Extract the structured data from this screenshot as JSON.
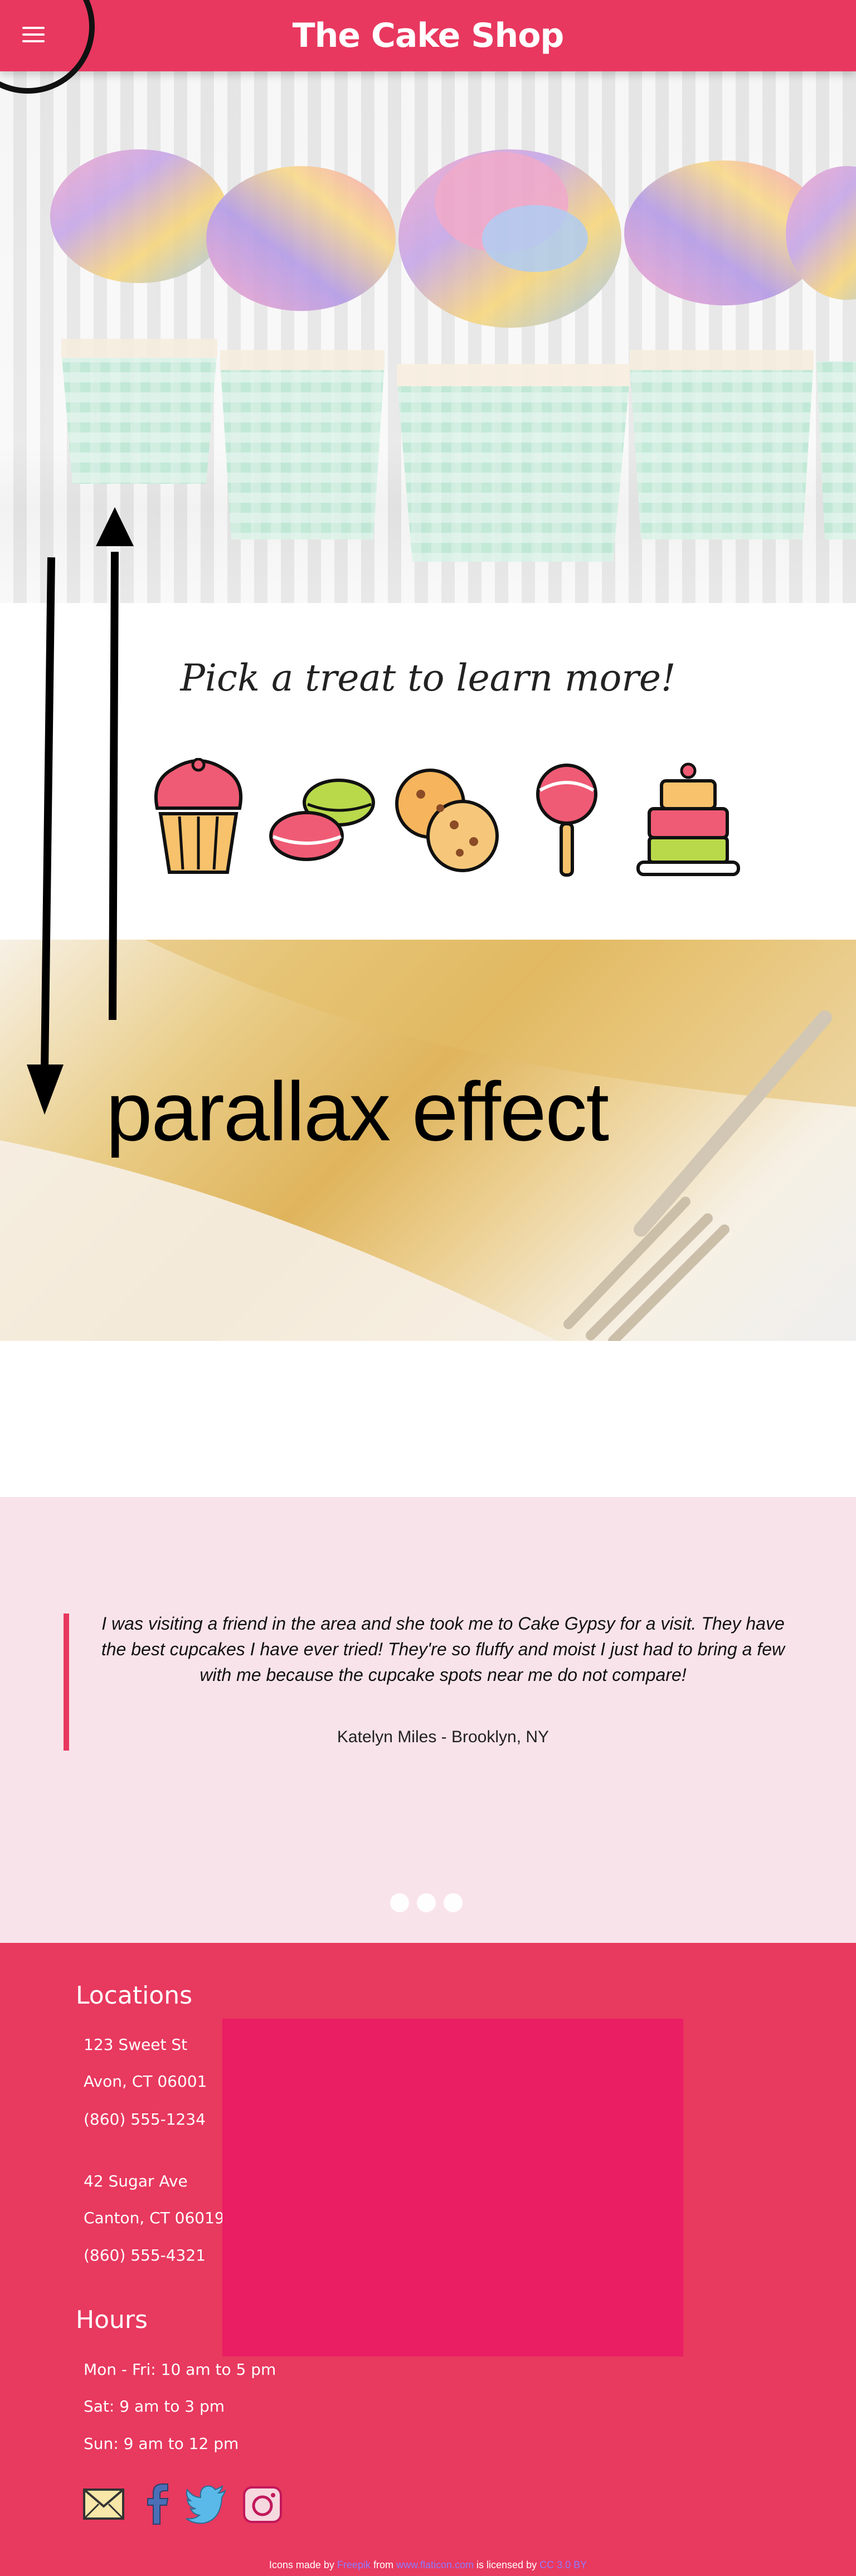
{
  "header": {
    "title": "The Cake Shop",
    "menu_icon": "hamburger-menu-icon",
    "color": "#e8385f"
  },
  "treats": {
    "title": "Pick a treat to learn more!",
    "items": [
      {
        "name": "cupcake",
        "icon": "cupcake-icon"
      },
      {
        "name": "macarons",
        "icon": "macaron-icon"
      },
      {
        "name": "cookies",
        "icon": "cookie-icon"
      },
      {
        "name": "cake pop",
        "icon": "cake-pop-icon"
      },
      {
        "name": "cake",
        "icon": "layer-cake-icon"
      }
    ]
  },
  "parallax": {
    "text": "parallax effect"
  },
  "testimonial": {
    "quote": "I was visiting a friend in the area and she took me to Cake Gypsy for a visit. They have the best cupcakes I have ever tried! They're so fluffy and moist I just had to bring a few with me because the cupcake spots near me do not compare!",
    "author": "Katelyn Miles - Brooklyn, NY",
    "slides": 3,
    "active_slide": 1
  },
  "footer": {
    "locations_title": "Locations",
    "locations": [
      {
        "street": "123 Sweet St",
        "city": "Avon, CT 06001",
        "phone": "(860) 555-1234"
      },
      {
        "street": "42 Sugar Ave",
        "city": "Canton, CT 06019",
        "phone": "(860) 555-4321"
      }
    ],
    "hours_title": "Hours",
    "hours": [
      "Mon - Fri: 10 am to 5 pm",
      "Sat: 9 am to 3 pm",
      "Sun: 9 am to 12 pm"
    ],
    "social": [
      "email-icon",
      "facebook-icon",
      "twitter-icon",
      "instagram-icon"
    ],
    "map_color": "#e91e63"
  },
  "attribution": {
    "prefix": "Icons made by",
    "author": "Freepik",
    "from": "from",
    "site": "www.flaticon.com",
    "licensed": "is licensed by",
    "license": "CC 3.0 BY"
  }
}
